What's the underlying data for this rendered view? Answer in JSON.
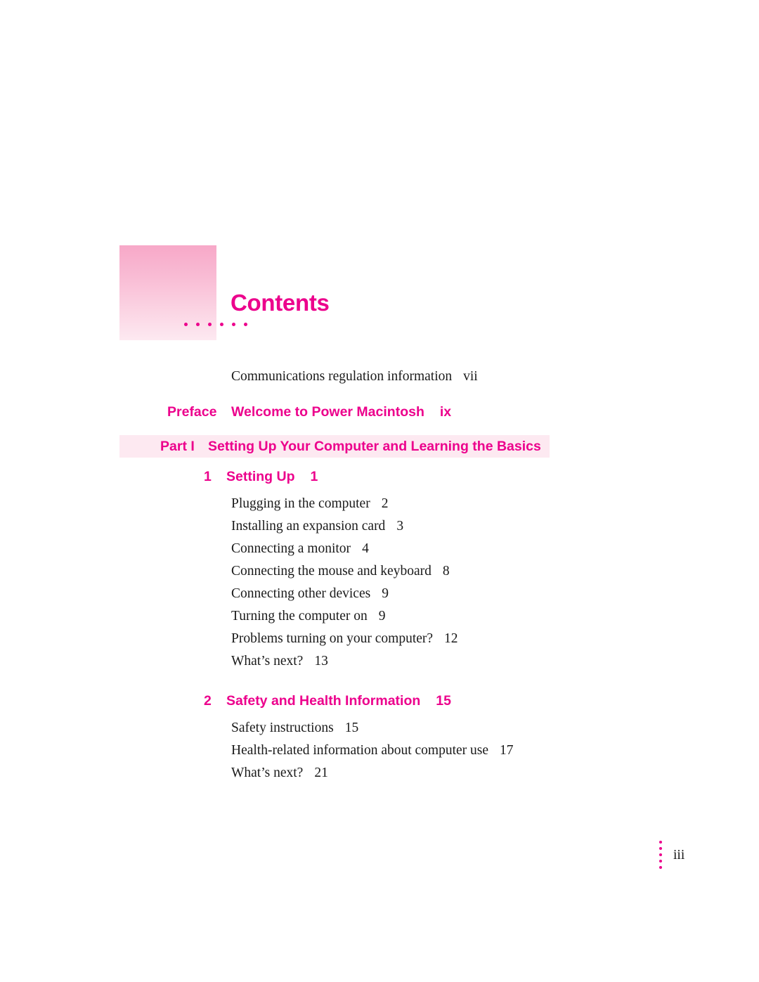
{
  "page": {
    "title": "Contents",
    "folio": "iii"
  },
  "toc": {
    "top_entry": {
      "label": "Communications regulation information",
      "page": "vii"
    },
    "preface": {
      "label": "Preface",
      "title": "Welcome to Power Macintosh",
      "page": "ix"
    },
    "part": {
      "label": "Part I",
      "title": "Setting Up Your Computer and Learning the Basics"
    },
    "chapters": [
      {
        "number": "1",
        "title": "Setting Up",
        "page": "1",
        "entries": [
          {
            "label": "Plugging in the computer",
            "page": "2"
          },
          {
            "label": "Installing an expansion card",
            "page": "3"
          },
          {
            "label": "Connecting a monitor",
            "page": "4"
          },
          {
            "label": "Connecting the mouse and keyboard",
            "page": "8"
          },
          {
            "label": "Connecting other devices",
            "page": "9"
          },
          {
            "label": "Turning the computer on",
            "page": "9"
          },
          {
            "label": "Problems turning on your computer?",
            "page": "12"
          },
          {
            "label": "What’s next?",
            "page": "13"
          }
        ]
      },
      {
        "number": "2",
        "title": "Safety and Health Information",
        "page": "15",
        "entries": [
          {
            "label": "Safety instructions",
            "page": "15"
          },
          {
            "label": "Health-related information about computer use",
            "page": "17"
          },
          {
            "label": "What’s next?",
            "page": "21"
          }
        ]
      }
    ]
  },
  "colors": {
    "accent": "#ec008c",
    "band": "#fde9f1",
    "text": "#1a1a1a"
  }
}
